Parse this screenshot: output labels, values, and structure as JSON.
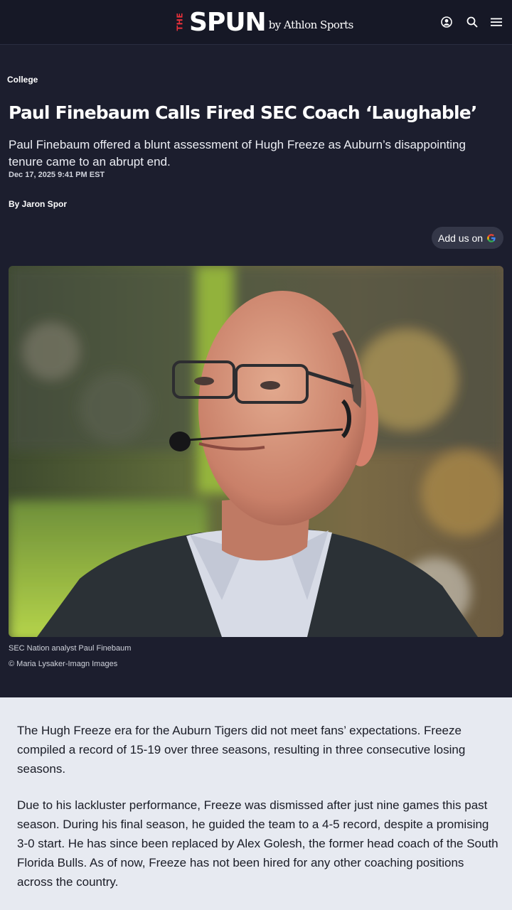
{
  "header": {
    "logo_the": "THE",
    "logo_spun": "SPUN",
    "logo_by": "by Athlon Sports",
    "icons": [
      "user-icon",
      "search-icon",
      "menu-icon"
    ]
  },
  "article": {
    "category": "College",
    "title": "Paul Finebaum Calls Fired SEC Coach ‘Laughable’",
    "dek": "Paul Finebaum offered a blunt assessment of Hugh Freeze as Auburn’s disappointing tenure came to an abrupt end.",
    "date": "Dec 17, 2025 9:41 PM EST",
    "byline": "By Jaron Spor",
    "add_us": "Add us on",
    "image_caption": "SEC Nation analyst Paul Finebaum",
    "image_credit": "© Maria Lysaker-Imagn Images",
    "paragraphs": [
      "The Hugh Freeze era for the Auburn Tigers did not meet fans’ expectations. Freeze compiled a record of 15-19 over three seasons, resulting in three consecutive losing seasons.",
      "Due to his lackluster performance, Freeze was dismissed after just nine games this past season. During his final season, he guided the team to a 4-5 record, despite a promising 3-0 start. He has since been replaced by Alex Golesh, the former head coach of the South Florida Bulls. As of now, Freeze has not been hired for any other coaching positions across the country."
    ]
  },
  "colors": {
    "background": "#1c1e2e",
    "header": "#161826",
    "body_background": "#e7eaf1",
    "logo_red": "#e8313a"
  }
}
